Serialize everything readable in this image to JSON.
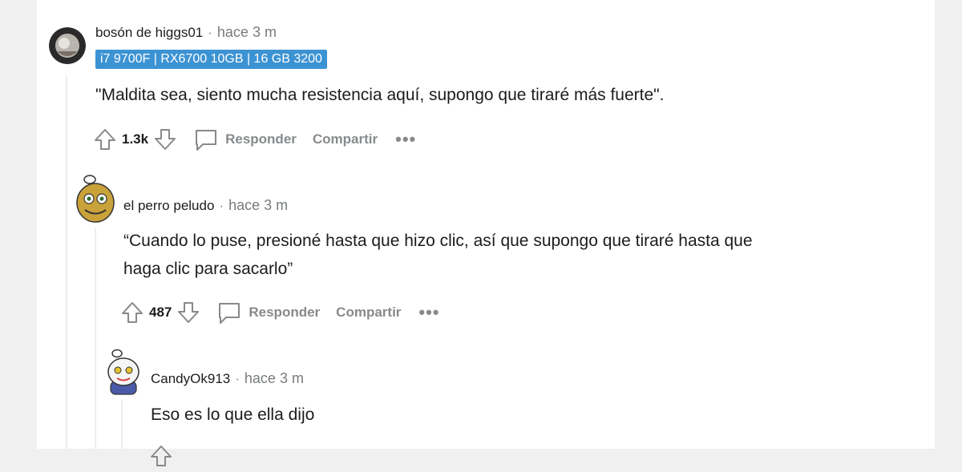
{
  "comments": [
    {
      "author": "bosón de higgs01",
      "separator": "·",
      "time": "hace 3 m",
      "flair": "i7 9700F |  RX6700 10GB |  16 GB 3200",
      "body": "\"Maldita sea, siento mucha resistencia aquí, supongo que tiraré más fuerte\".",
      "score": "1.3k",
      "reply_label": "Responder",
      "share_label": "Compartir",
      "more_label": "•••"
    },
    {
      "author": "el perro peludo",
      "separator": "·",
      "time": "hace 3 m",
      "body_line1": "“Cuando lo puse, presioné hasta que hizo clic, así que supongo que tiraré hasta que",
      "body_line2": "haga clic para sacarlo”",
      "score": "487",
      "reply_label": "Responder",
      "share_label": "Compartir",
      "more_label": "•••"
    },
    {
      "author": "CandyOk913",
      "separator": "·",
      "time": "hace 3 m",
      "body": "Eso es lo que ella dijo"
    }
  ],
  "colors": {
    "flair_bg": "#3c93d3",
    "meta_gray": "#878a8c",
    "thread_line": "#edeff1"
  }
}
